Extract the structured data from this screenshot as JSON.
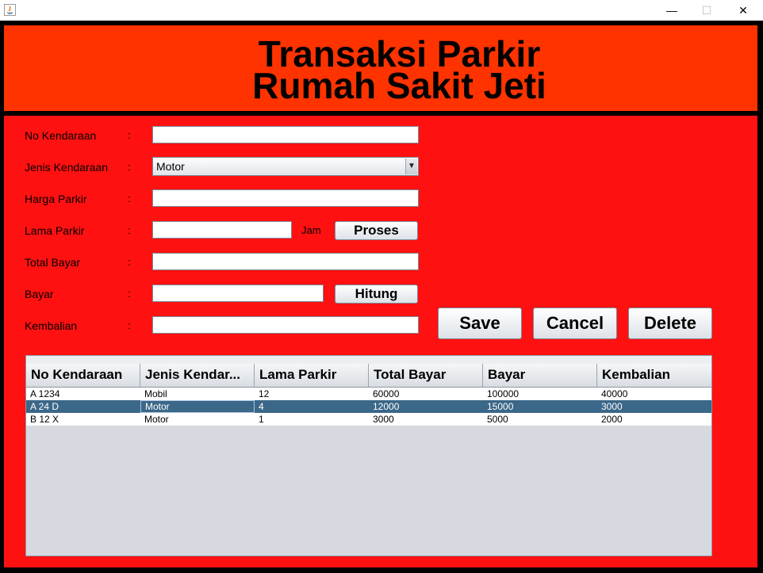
{
  "window": {
    "minimize": "—",
    "maximize": "☐",
    "close": "✕"
  },
  "header": {
    "line1": "Transaksi Parkir",
    "line2": "Rumah Sakit Jeti"
  },
  "form": {
    "labels": {
      "no_kendaraan": "No Kendaraan",
      "jenis_kendaraan": "Jenis Kendaraan",
      "harga_parkir": "Harga Parkir",
      "lama_parkir": "Lama Parkir",
      "total_bayar": "Total  Bayar",
      "bayar": "Bayar",
      "kembalian": "Kembalian"
    },
    "colon": ":",
    "values": {
      "no_kendaraan": "",
      "jenis_kendaraan": "Motor",
      "harga_parkir": "",
      "lama_parkir": "",
      "total_bayar": "",
      "bayar": "",
      "kembalian": ""
    },
    "jam_label": "Jam",
    "proses_button": "Proses",
    "hitung_button": "Hitung",
    "save_button": "Save",
    "cancel_button": "Cancel",
    "delete_button": "Delete"
  },
  "table": {
    "columns": [
      "No Kendaraan",
      "Jenis Kendar...",
      "Lama Parkir",
      "Total Bayar",
      "Bayar",
      "Kembalian"
    ],
    "rows": [
      [
        "A 1234",
        "Mobil",
        "12",
        "60000",
        "100000",
        "40000"
      ],
      [
        "A 24 D",
        "Motor",
        "4",
        "12000",
        "15000",
        "3000"
      ],
      [
        "B 12 X",
        "Motor",
        "1",
        "3000",
        "5000",
        "2000"
      ]
    ],
    "selected_row": 1
  },
  "colors": {
    "header_bg": "#ff3300",
    "form_bg": "#ff1111",
    "selection": "#3b6788"
  }
}
